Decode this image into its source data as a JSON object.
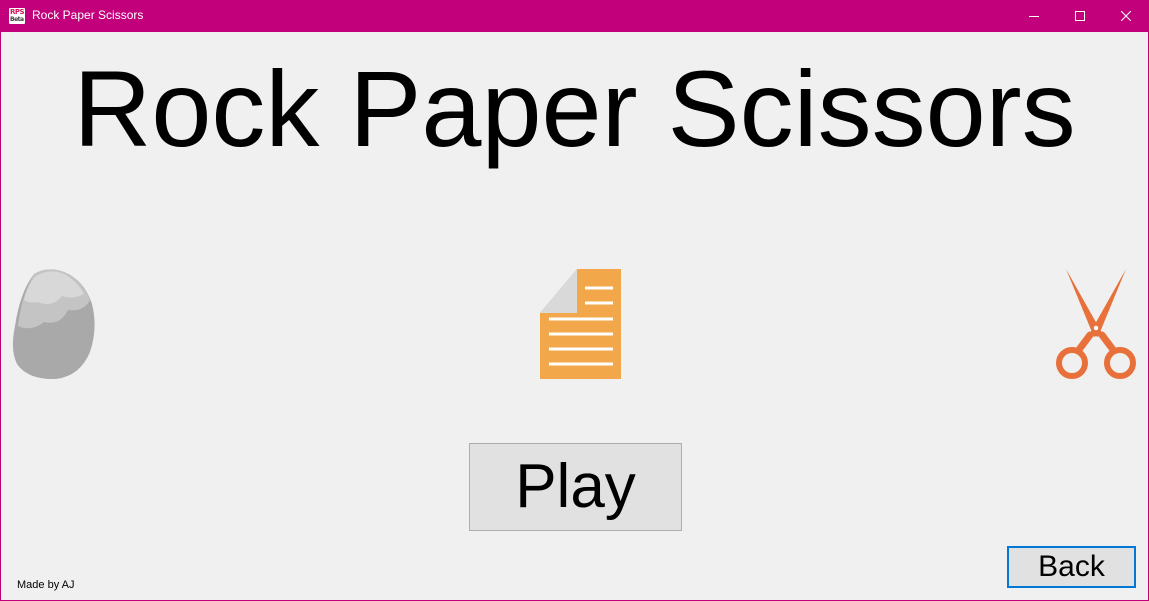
{
  "window": {
    "title": "Rock Paper Scissors",
    "icon_text_top": "RPS",
    "icon_text_bottom": "Beta",
    "titlebar_color": "#c3007b"
  },
  "controls": {
    "minimize_icon": "minimize-icon",
    "maximize_icon": "maximize-icon",
    "close_icon": "close-icon"
  },
  "game": {
    "title": "Rock Paper Scissors",
    "choices": [
      {
        "name": "rock",
        "icon": "rock-icon",
        "color": "#b4b4b4"
      },
      {
        "name": "paper",
        "icon": "paper-icon",
        "color": "#f2a84a"
      },
      {
        "name": "scissors",
        "icon": "scissors-icon",
        "color": "#e8703a"
      }
    ],
    "play_label": "Play",
    "back_label": "Back",
    "credit": "Made by AJ"
  }
}
